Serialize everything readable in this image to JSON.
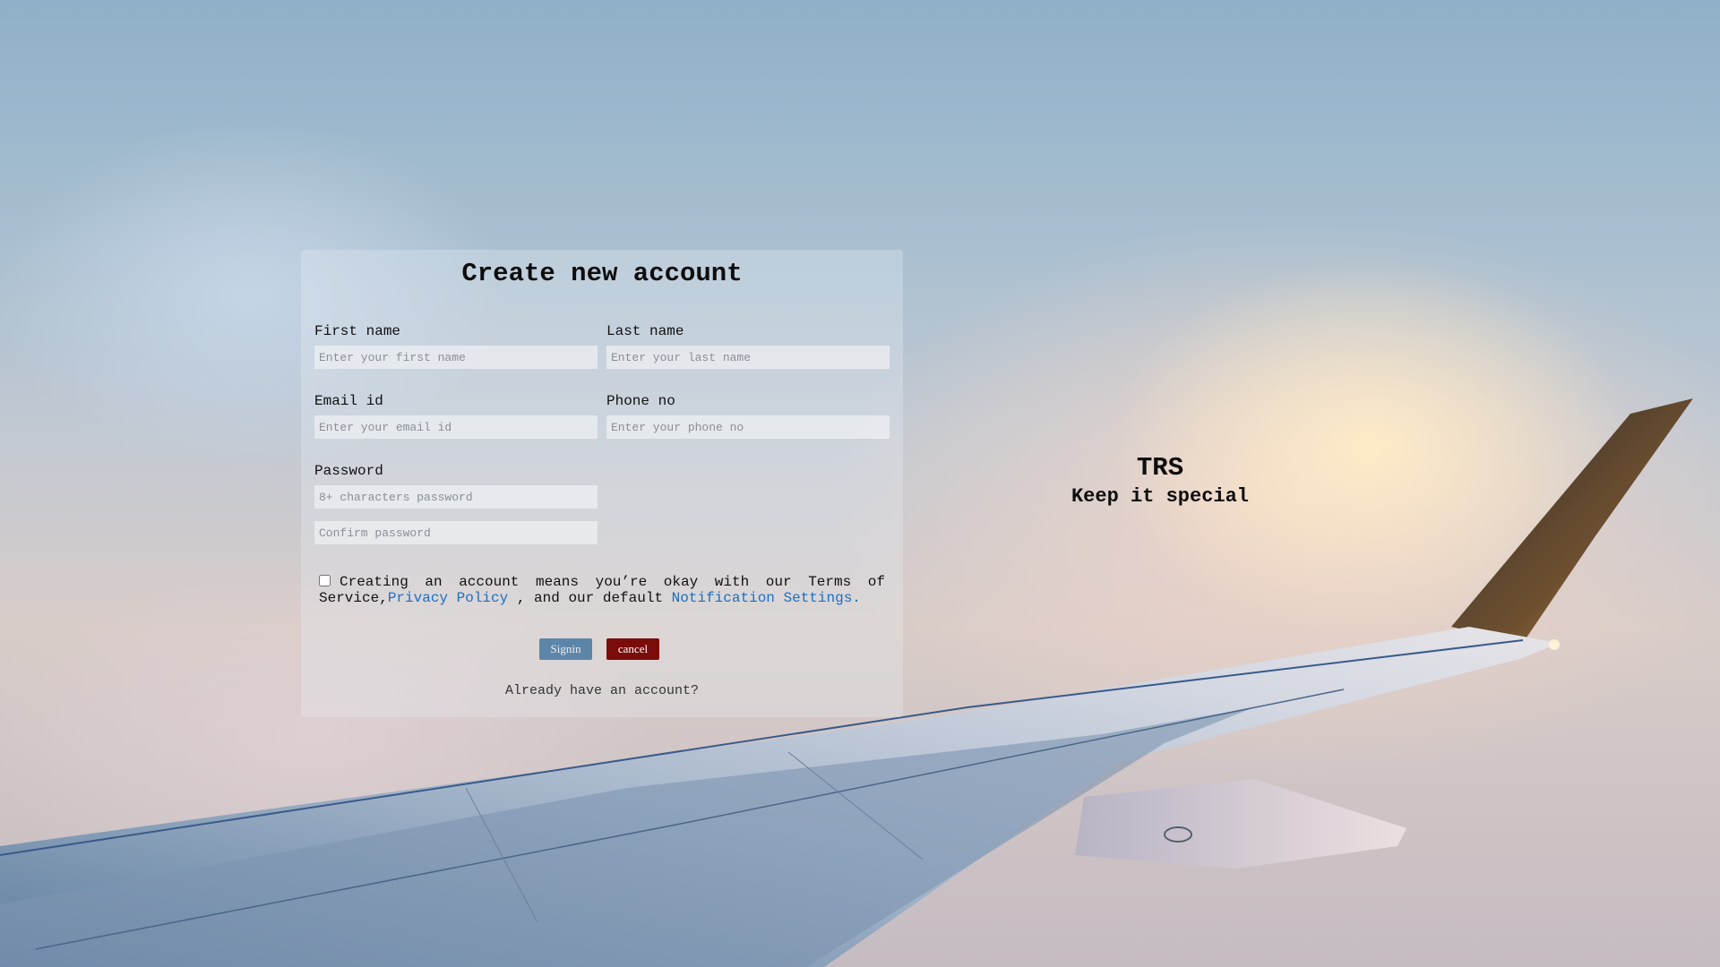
{
  "form": {
    "title": "Create new account",
    "first_name": {
      "label": "First name",
      "placeholder": "Enter your first name"
    },
    "last_name": {
      "label": "Last name",
      "placeholder": "Enter your last name"
    },
    "email": {
      "label": "Email id",
      "placeholder": "Enter your email id"
    },
    "phone": {
      "label": "Phone no",
      "placeholder": "Enter your phone no"
    },
    "password": {
      "label": "Password",
      "placeholder": "8+ characters password"
    },
    "confirm_password": {
      "placeholder": "Confirm password"
    },
    "terms": {
      "checked": false,
      "text_before": "Creating an account means you’re okay with our Terms of Service,",
      "privacy_link": "Privacy Policy",
      "text_middle": " , and our default ",
      "notification_link": "Notification Settings."
    },
    "buttons": {
      "signin": "Signin",
      "cancel": "cancel"
    },
    "already": "Already have an account?"
  },
  "brand": {
    "name": "TRS",
    "tagline": "Keep it special"
  },
  "colors": {
    "signin_button": "#5d85a8",
    "cancel_button": "#7a0c0c",
    "link": "#1a6fc4"
  }
}
